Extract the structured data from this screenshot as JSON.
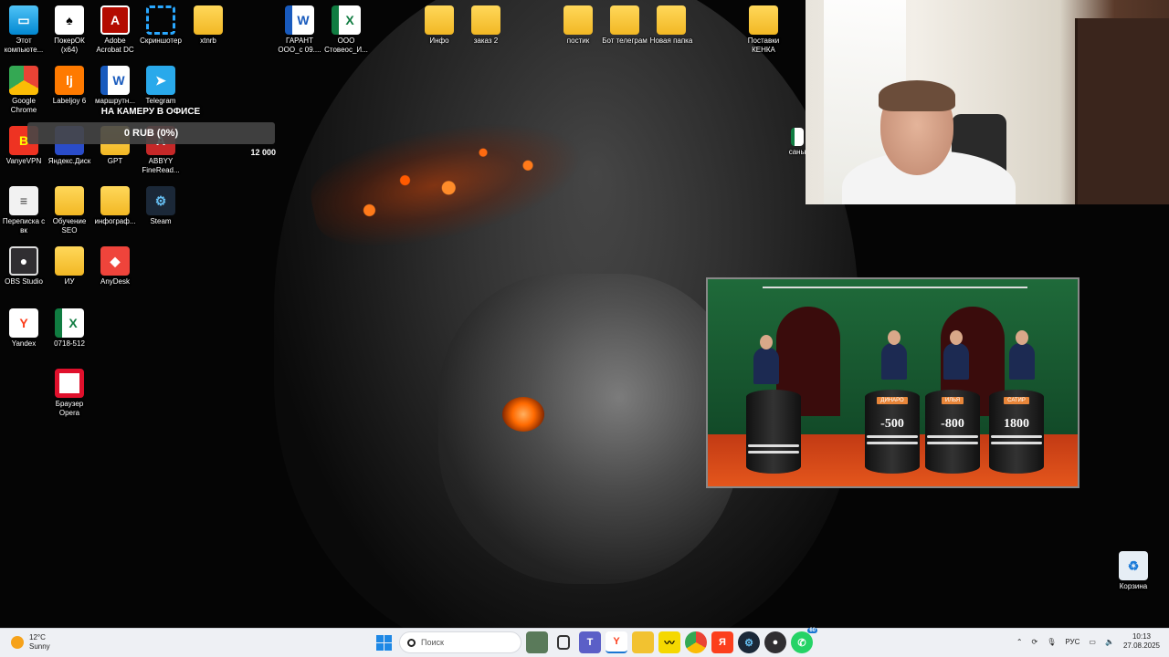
{
  "desktop": {
    "icons": [
      {
        "label": "Этот компьюте...",
        "icon": "computer-icon"
      },
      {
        "label": "ПокерОК (x64)",
        "icon": "poker-icon"
      },
      {
        "label": "Adobe Acrobat DC",
        "icon": "acrobat-icon"
      },
      {
        "label": "Скриншотер",
        "icon": "screenshot-icon"
      },
      {
        "label": "xtnrb",
        "icon": "folder-icon"
      },
      {
        "label": "ГАРАНТ ООО_с 09....",
        "icon": "word-icon"
      },
      {
        "label": "ООО Стовеос_И...",
        "icon": "excel-icon"
      },
      {
        "label": "Инфо",
        "icon": "folder-icon"
      },
      {
        "label": "заказ 2",
        "icon": "folder-icon"
      },
      {
        "label": "постик",
        "icon": "folder-icon"
      },
      {
        "label": "Бот телеграм",
        "icon": "folder-icon"
      },
      {
        "label": "Новая папка",
        "icon": "folder-icon"
      },
      {
        "label": "Поставки КЕНКА",
        "icon": "folder-icon"
      },
      {
        "label": "Google Chrome",
        "icon": "chrome-icon"
      },
      {
        "label": "Labeljoy 6",
        "icon": "labeljoy-icon"
      },
      {
        "label": "маршрутн...",
        "icon": "word-icon"
      },
      {
        "label": "Telegram",
        "icon": "telegram-icon"
      },
      {
        "label": "VanyeVPN",
        "icon": "vpn-icon"
      },
      {
        "label": "Яндекс.Диск",
        "icon": "yandex-disk-icon"
      },
      {
        "label": "GPT",
        "icon": "folder-icon"
      },
      {
        "label": "ABBYY FineRead...",
        "icon": "abbyy-icon"
      },
      {
        "label": "Переписка с вк",
        "icon": "document-icon"
      },
      {
        "label": "Обучение SEO",
        "icon": "folder-icon"
      },
      {
        "label": "инфограф...",
        "icon": "folder-icon"
      },
      {
        "label": "Steam",
        "icon": "steam-icon"
      },
      {
        "label": "OBS Studio",
        "icon": "obs-icon"
      },
      {
        "label": "ИУ",
        "icon": "folder-icon"
      },
      {
        "label": "AnyDesk",
        "icon": "anydesk-icon"
      },
      {
        "label": "Yandex",
        "icon": "yandex-icon"
      },
      {
        "label": "0718-512",
        "icon": "excel-icon"
      },
      {
        "label": "Браузер Opera",
        "icon": "opera-icon"
      },
      {
        "label": "Корзина",
        "icon": "recycle-bin-icon"
      },
      {
        "label": "саны",
        "icon": "excel-icon"
      }
    ],
    "icon_glyphs": {
      "computer": "▭",
      "poker": "♠",
      "acrobat": "A",
      "word": "W",
      "excel": "X",
      "chrome": "",
      "labeljoy": "lj",
      "telegram": "➤",
      "vpn": "B",
      "abbyy": "A",
      "doc": "≡",
      "steam": "⚙",
      "obs": "●",
      "anydesk": "◆",
      "yandex": "Y",
      "trash": "♻"
    }
  },
  "donation_overlay": {
    "title": "НА КАМЕРУ В ОФИСЕ",
    "amount": "0 RUB (0%)",
    "goal": "12 000",
    "progress": 0
  },
  "video": {
    "contestants": [
      {
        "name": "ДИНАРО",
        "score": "-500"
      },
      {
        "name": "ИЛЬЯ",
        "score": "-800"
      },
      {
        "name": "САТИР",
        "score": "1800"
      }
    ]
  },
  "taskbar": {
    "weather_temp": "12°C",
    "weather_desc": "Sunny",
    "search_placeholder": "Поиск",
    "lang": "РУС",
    "time": "10:13",
    "date": "27.08.2025",
    "whatsapp_badge": "60",
    "apps": [
      "start",
      "search",
      "game-app",
      "task-view",
      "teams",
      "yandex-browser",
      "file-explorer",
      "tradingview",
      "chrome",
      "yandex",
      "steam",
      "obs",
      "whatsapp"
    ]
  },
  "colors": {
    "taskbar_bg": "#eef0f4",
    "accent": "#1e88e5",
    "overlay_bar": "#464646",
    "lava": "#ff6a00"
  }
}
